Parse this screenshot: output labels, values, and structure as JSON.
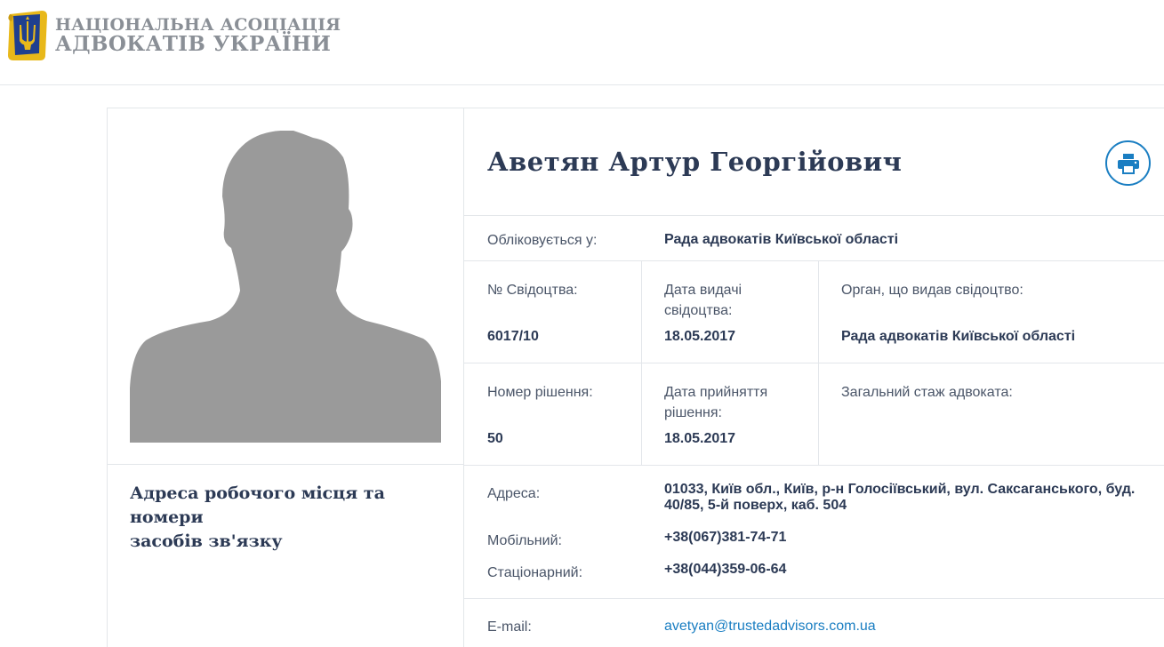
{
  "header": {
    "logo_line1": "НАЦІОНАЛЬНА АСОЦІАЦІЯ",
    "logo_line2": "АДВОКАТІВ УКРАЇНИ"
  },
  "profile": {
    "name": "Аветян Артур Георгійович"
  },
  "registry": {
    "registered_label": "Обліковується у:",
    "registered_value": "Рада адвокатів Київської області",
    "cert_no_label": "№ Свідоцтва:",
    "cert_no_value": "6017/10",
    "cert_date_label_1": "Дата видачі",
    "cert_date_label_2": "свідоцтва:",
    "cert_date_value": "18.05.2017",
    "issuer_label": "Орган, що видав свідоцтво:",
    "issuer_value": "Рада адвокатів Київської області",
    "decision_no_label": "Номер рішення:",
    "decision_no_value": "50",
    "decision_date_label_1": "Дата прийняття",
    "decision_date_label_2": "рішення:",
    "decision_date_value": "18.05.2017",
    "experience_label": "Загальний стаж адвоката:"
  },
  "contacts": {
    "heading_line1": "Адреса робочого місця та номери",
    "heading_line2": "засобів зв'язку",
    "address_label": "Адреса:",
    "address_line1": "01033, Київ обл., Київ, р-н Голосіївський, вул. Саксаганського, буд.",
    "address_line2": "40/85, 5-й поверх, каб. 504",
    "mobile_label": "Мобільний:",
    "mobile_value": "+38(067)381-74-71",
    "landline_label": "Стаціонарний:",
    "landline_value": "+38(044)359-06-64",
    "email_label": "E-mail:",
    "email_value": "avetyan@trustedadvisors.com.ua"
  },
  "colors": {
    "accent": "#1a7ec2",
    "text": "#2c3a55",
    "border": "#e3e6ea",
    "silhouette": "#9a9a9a",
    "logo_gold": "#e8b81a",
    "logo_blue": "#1f3f8f"
  },
  "icons": {
    "print": "printer-icon",
    "logo": "trident-logo-icon",
    "avatar": "person-silhouette"
  }
}
